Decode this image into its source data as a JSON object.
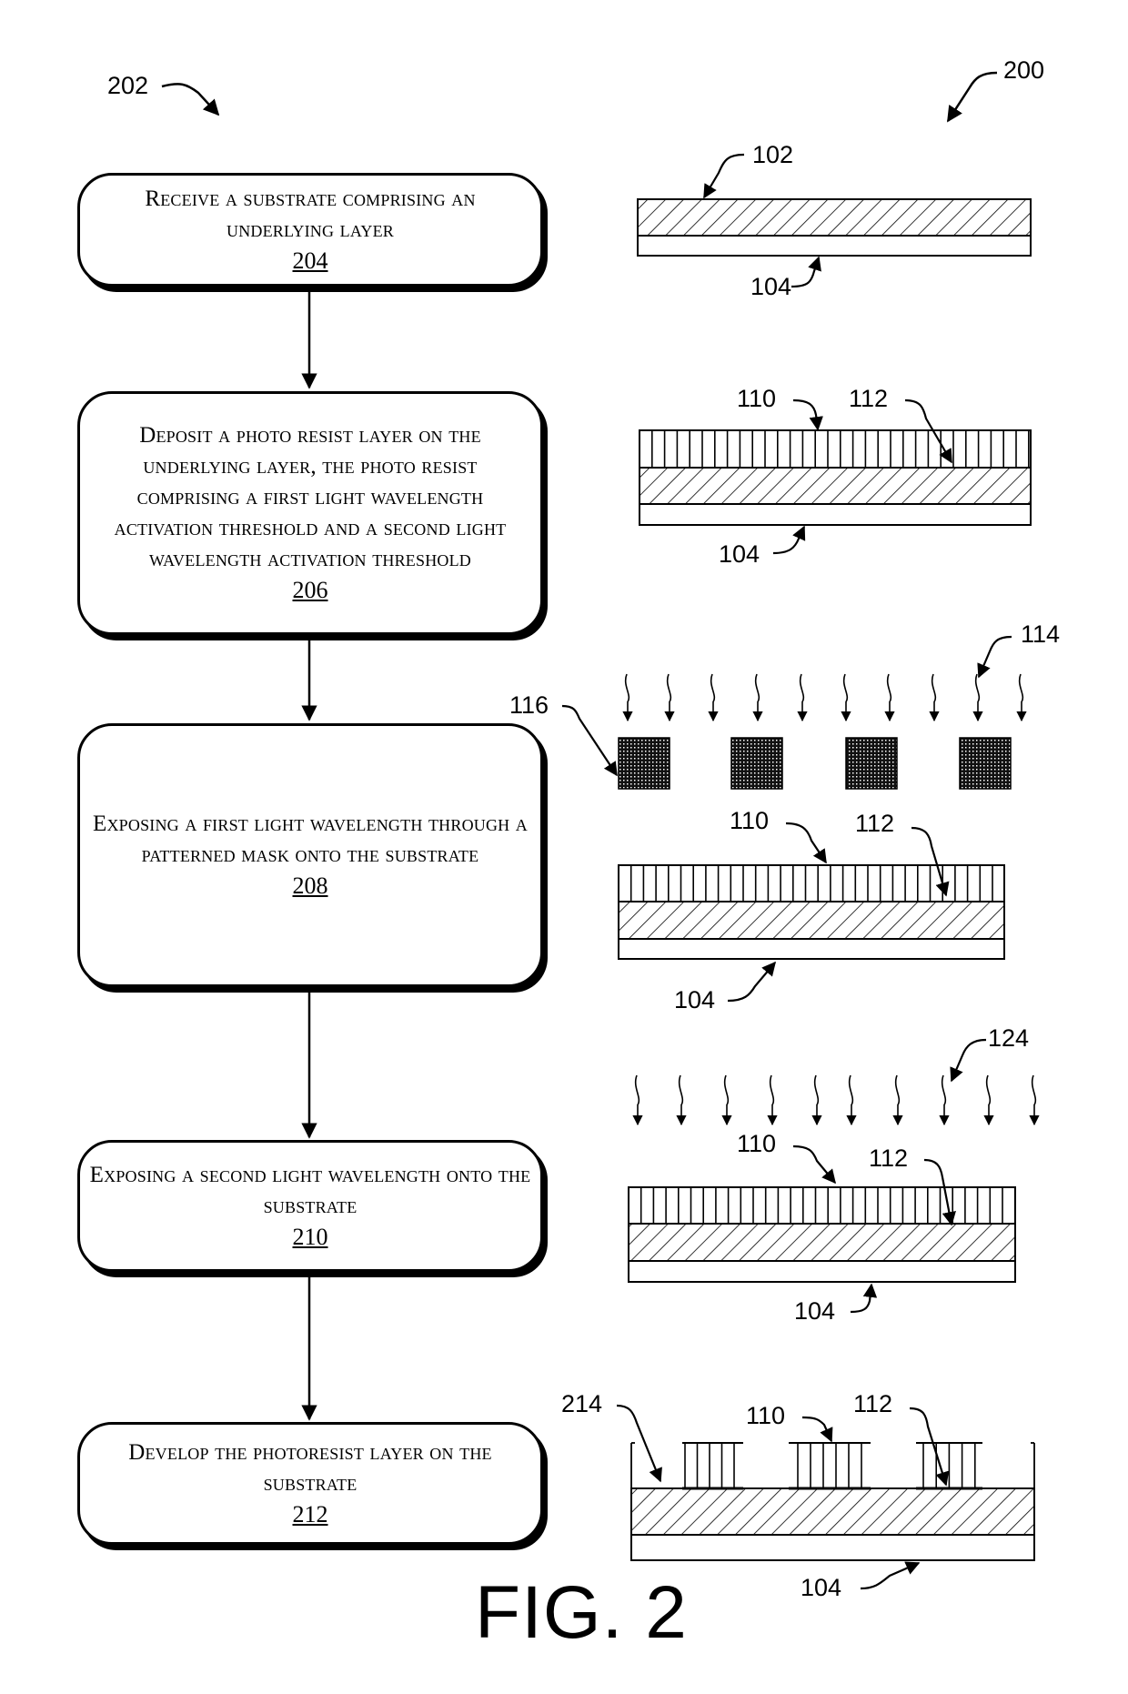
{
  "figure": {
    "title": "FIG. 2",
    "method_ref": "202",
    "structure_ref": "200"
  },
  "steps": [
    {
      "text": "Receive a substrate comprising an underlying layer",
      "number": "204"
    },
    {
      "text": "Deposit a photo resist layer on the underlying layer, the photo resist comprising a first light wavelength activation threshold and a second light wavelength activation threshold",
      "number": "206"
    },
    {
      "text": "Exposing a first light wavelength through a patterned mask onto the substrate",
      "number": "208"
    },
    {
      "text": "Exposing a second light wavelength onto the substrate",
      "number": "210"
    },
    {
      "text": "Develop the photoresist layer on the substrate",
      "number": "212"
    }
  ],
  "stages": [
    {
      "refs": {
        "underlying_layer": "102",
        "substrate": "104"
      }
    },
    {
      "refs": {
        "photoresist": "110",
        "underlying_layer": "112",
        "substrate": "104"
      }
    },
    {
      "refs": {
        "light": "114",
        "mask": "116",
        "photoresist": "110",
        "underlying_layer": "112",
        "substrate": "104"
      }
    },
    {
      "refs": {
        "light": "124",
        "photoresist": "110",
        "underlying_layer": "112",
        "substrate": "104"
      }
    },
    {
      "refs": {
        "opening": "214",
        "photoresist": "110",
        "underlying_layer": "112",
        "substrate": "104"
      }
    }
  ],
  "colors": {
    "ink": "#000000",
    "paper": "#ffffff"
  }
}
